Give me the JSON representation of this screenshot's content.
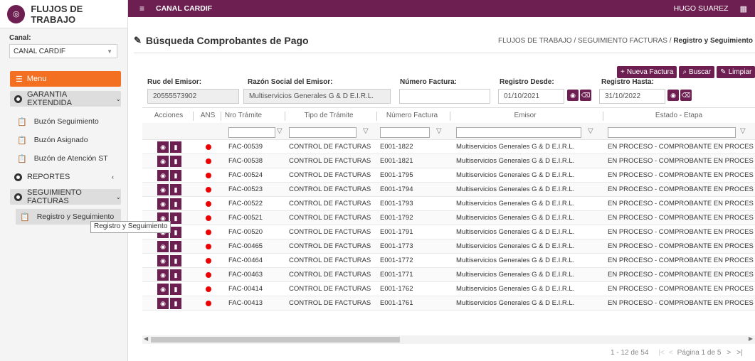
{
  "brand": {
    "title": "FLUJOS DE TRABAJO",
    "logo_icon": "workflow-icon"
  },
  "sidebar": {
    "canal_label": "Canal:",
    "canal_value": "CANAL CARDIF",
    "menu_label": "Menu",
    "groups": [
      {
        "label": "GARANTIA EXTENDIDA"
      },
      {
        "label": "REPORTES"
      },
      {
        "label": "SEGUIMIENTO FACTURAS"
      }
    ],
    "garantia_items": [
      "Buzón Seguimiento",
      "Buzón Asignado",
      "Buzón de Atención ST"
    ],
    "seguimiento_items": [
      "Registro y Seguimiento"
    ],
    "tooltip": "Registro  y  Seguimiento"
  },
  "topbar": {
    "canal": "CANAL CARDIF",
    "user": "HUGO SUAREZ"
  },
  "header": {
    "title": "Búsqueda Comprobantes de Pago",
    "breadcrumb_path": "FLUJOS DE TRABAJO / SEGUIMIENTO FACTURAS / ",
    "breadcrumb_current": "Registro y Seguimiento"
  },
  "actions": {
    "new": "Nueva Factura",
    "search": "Buscar",
    "clear": "Limpiar"
  },
  "filters": {
    "ruc_label": "Ruc del Emisor:",
    "ruc_value": "20555573902",
    "razon_label": "Razón Social del Emisor:",
    "razon_value": "Multiservicios Generales G & D E.I.R.L.",
    "factura_label": "Número Factura:",
    "factura_value": "",
    "desde_label": "Registro Desde:",
    "desde_value": "01/10/2021",
    "hasta_label": "Registro Hasta:",
    "hasta_value": "31/10/2022"
  },
  "table": {
    "columns": [
      "Acciones",
      "ANS",
      "Nro Trámite",
      "Tipo de Trámite",
      "Número Factura",
      "Emisor",
      "Estado - Etapa"
    ],
    "rows": [
      [
        "FAC-00539",
        "CONTROL DE FACTURAS",
        "E001-1822",
        "Multiservicios Generales G & D E.I.R.L.",
        "EN PROCESO - COMPROBANTE EN PROCESO DE ..."
      ],
      [
        "FAC-00538",
        "CONTROL DE FACTURAS",
        "E001-1821",
        "Multiservicios Generales G & D E.I.R.L.",
        "EN PROCESO - COMPROBANTE EN PROCESO DE ..."
      ],
      [
        "FAC-00524",
        "CONTROL DE FACTURAS",
        "E001-1795",
        "Multiservicios Generales G & D E.I.R.L.",
        "EN PROCESO - COMPROBANTE EN PROCESO DE ..."
      ],
      [
        "FAC-00523",
        "CONTROL DE FACTURAS",
        "E001-1794",
        "Multiservicios Generales G & D E.I.R.L.",
        "EN PROCESO - COMPROBANTE EN PROCESO DE ..."
      ],
      [
        "FAC-00522",
        "CONTROL DE FACTURAS",
        "E001-1793",
        "Multiservicios Generales G & D E.I.R.L.",
        "EN PROCESO - COMPROBANTE EN PROCESO DE ..."
      ],
      [
        "FAC-00521",
        "CONTROL DE FACTURAS",
        "E001-1792",
        "Multiservicios Generales G & D E.I.R.L.",
        "EN PROCESO - COMPROBANTE EN PROCESO DE ..."
      ],
      [
        "FAC-00520",
        "CONTROL DE FACTURAS",
        "E001-1791",
        "Multiservicios Generales G & D E.I.R.L.",
        "EN PROCESO - COMPROBANTE EN PROCESO DE ..."
      ],
      [
        "FAC-00465",
        "CONTROL DE FACTURAS",
        "E001-1773",
        "Multiservicios Generales G & D E.I.R.L.",
        "EN PROCESO - COMPROBANTE EN PROCESO DE ..."
      ],
      [
        "FAC-00464",
        "CONTROL DE FACTURAS",
        "E001-1772",
        "Multiservicios Generales G & D E.I.R.L.",
        "EN PROCESO - COMPROBANTE EN PROCESO DE ..."
      ],
      [
        "FAC-00463",
        "CONTROL DE FACTURAS",
        "E001-1771",
        "Multiservicios Generales G & D E.I.R.L.",
        "EN PROCESO - COMPROBANTE EN PROCESO DE ..."
      ],
      [
        "FAC-00414",
        "CONTROL DE FACTURAS",
        "E001-1762",
        "Multiservicios Generales G & D E.I.R.L.",
        "EN PROCESO - COMPROBANTE EN PROCESO DE ..."
      ],
      [
        "FAC-00413",
        "CONTROL DE FACTURAS",
        "E001-1761",
        "Multiservicios Generales G & D E.I.R.L.",
        "EN PROCESO - COMPROBANTE EN PROCESO DE ..."
      ]
    ]
  },
  "pager": {
    "range": "1 - 12 de 54",
    "page": "Página 1 de 5"
  },
  "colors": {
    "primary": "#6e1f52",
    "menu": "#f36f21",
    "ans_dot": "#e00000"
  }
}
